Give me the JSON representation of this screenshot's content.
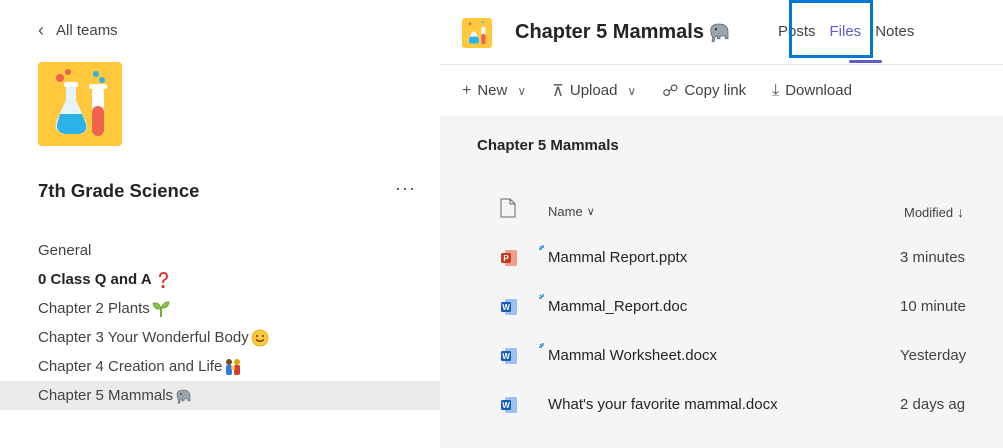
{
  "sidebar": {
    "back_label": "All teams",
    "team_name": "7th Grade Science",
    "more_label": "···",
    "channels": [
      {
        "label": "General",
        "emoji": ""
      },
      {
        "label": "0 Class Q and A",
        "emoji": "question-mark-icon"
      },
      {
        "label": "Chapter 2 Plants",
        "emoji": "seedling-icon"
      },
      {
        "label": "Chapter 3 Your Wonderful Body",
        "emoji": "smiley-face-icon"
      },
      {
        "label": "Chapter 4 Creation and Life",
        "emoji": "family-icon"
      },
      {
        "label": "Chapter 5 Mammals",
        "emoji": "elephant-icon"
      }
    ]
  },
  "header": {
    "channel_title": "Chapter 5 Mammals",
    "tabs": [
      {
        "label": "Posts"
      },
      {
        "label": "Files"
      },
      {
        "label": "Notes"
      }
    ],
    "active_tab": "Files"
  },
  "toolbar": {
    "new_label": "New",
    "upload_label": "Upload",
    "copy_link_label": "Copy link",
    "download_label": "Download"
  },
  "breadcrumb": "Chapter 5 Mammals",
  "files": {
    "col_name": "Name",
    "col_modified": "Modified",
    "rows": [
      {
        "name": "Mammal Report.pptx",
        "modified": "3 minutes",
        "type": "pptx",
        "new": true
      },
      {
        "name": "Mammal_Report.doc",
        "modified": "10 minute",
        "type": "docx",
        "new": true
      },
      {
        "name": "Mammal Worksheet.docx",
        "modified": "Yesterday",
        "type": "docx",
        "new": true
      },
      {
        "name": "What's your favorite mammal.docx",
        "modified": "2 days ag",
        "type": "docx",
        "new": false
      }
    ]
  },
  "colors": {
    "accent": "#5b5fc7",
    "highlight": "#0078d4",
    "logo_bg": "#ffc83d",
    "active_bg": "#ebebeb"
  }
}
